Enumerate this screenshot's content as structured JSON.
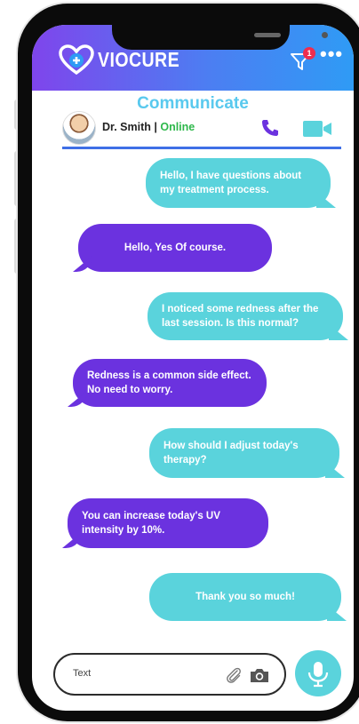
{
  "app": {
    "name": "VIOCURE"
  },
  "header": {
    "notification_count": "1",
    "more_label": "•••"
  },
  "page": {
    "title": "Communicate"
  },
  "doctor": {
    "name": "Dr. Smith",
    "separator": "|",
    "status": "Online"
  },
  "messages": [
    {
      "from": "patient",
      "text": "Hello, I have questions about my treatment process."
    },
    {
      "from": "doctor",
      "text": "Hello, Yes Of course."
    },
    {
      "from": "patient",
      "text": "I noticed some redness after the last session. Is this normal?"
    },
    {
      "from": "doctor",
      "text": "Redness is a common side effect. No need to worry."
    },
    {
      "from": "patient",
      "text": "How should I adjust today's therapy?"
    },
    {
      "from": "doctor",
      "text": "You can increase today's UV intensity by 10%."
    },
    {
      "from": "patient",
      "text": "Thank you so much!"
    }
  ],
  "composer": {
    "placeholder": "Text"
  },
  "icons": {
    "logo": "heart-plus-icon",
    "filter": "filter-icon",
    "call": "phone-icon",
    "video": "video-camera-icon",
    "attach": "paperclip-icon",
    "camera": "camera-icon",
    "mic": "microphone-icon"
  },
  "colors": {
    "header_start": "#7f45ec",
    "header_end": "#2f9bf5",
    "doctor_bubble": "#6b32df",
    "patient_bubble": "#5ad3dc",
    "title": "#59c9ee",
    "online": "#2eb84b"
  }
}
